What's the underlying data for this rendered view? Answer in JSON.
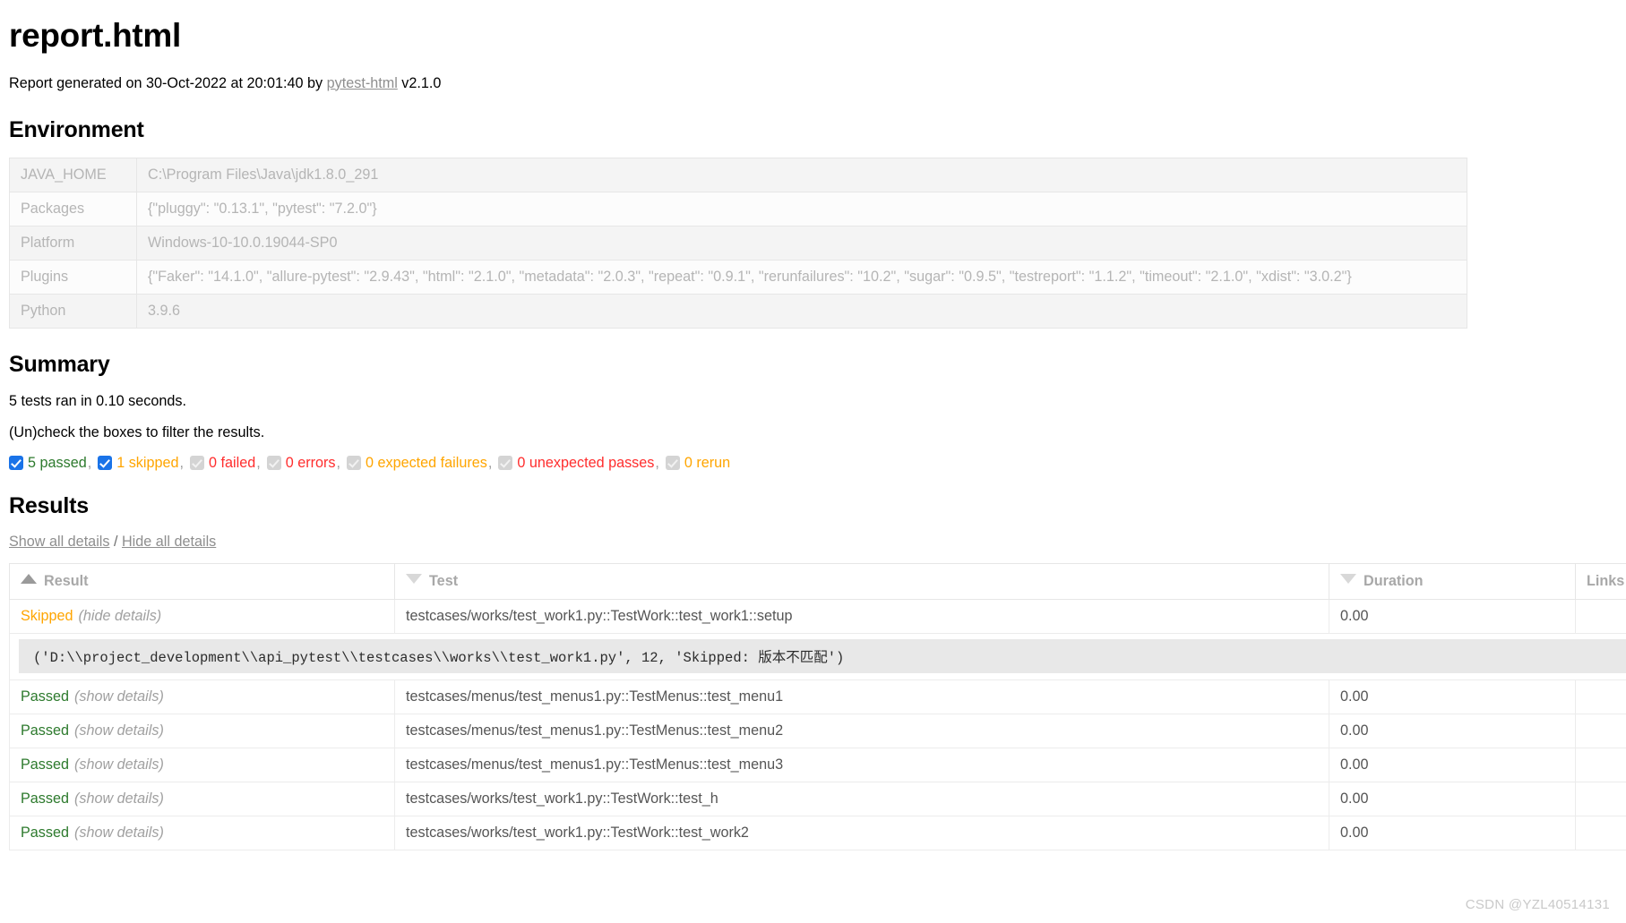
{
  "report": {
    "title": "report.html",
    "generated_prefix": "Report generated on",
    "date": "30-Oct-2022",
    "at_word": "at",
    "time": "20:01:40",
    "by_word": "by",
    "tool_link": "pytest-html",
    "tool_version": "v2.1.0"
  },
  "environment": {
    "heading": "Environment",
    "rows": [
      {
        "key": "JAVA_HOME",
        "value": "C:\\Program Files\\Java\\jdk1.8.0_291"
      },
      {
        "key": "Packages",
        "value": "{\"pluggy\": \"0.13.1\", \"pytest\": \"7.2.0\"}"
      },
      {
        "key": "Platform",
        "value": "Windows-10-10.0.19044-SP0"
      },
      {
        "key": "Plugins",
        "value": "{\"Faker\": \"14.1.0\", \"allure-pytest\": \"2.9.43\", \"html\": \"2.1.0\", \"metadata\": \"2.0.3\", \"repeat\": \"0.9.1\", \"rerunfailures\": \"10.2\", \"sugar\": \"0.9.5\", \"testreport\": \"1.1.2\", \"timeout\": \"2.1.0\", \"xdist\": \"3.0.2\"}"
      },
      {
        "key": "Python",
        "value": "3.9.6"
      }
    ]
  },
  "summary": {
    "heading": "Summary",
    "run_line": "5 tests ran in 0.10 seconds.",
    "filter_hint": "(Un)check the boxes to filter the results.",
    "filters": [
      {
        "label": "5 passed",
        "checked": true,
        "color_class": "c-passed",
        "trailing": ","
      },
      {
        "label": "1 skipped",
        "checked": true,
        "color_class": "c-skipped",
        "trailing": ","
      },
      {
        "label": "0 failed",
        "checked": false,
        "color_class": "c-failed",
        "trailing": ","
      },
      {
        "label": "0 errors",
        "checked": false,
        "color_class": "c-error",
        "trailing": ","
      },
      {
        "label": "0 expected failures",
        "checked": false,
        "color_class": "c-xfail",
        "trailing": ","
      },
      {
        "label": "0 unexpected passes",
        "checked": false,
        "color_class": "c-xpass",
        "trailing": ","
      },
      {
        "label": "0 rerun",
        "checked": false,
        "color_class": "c-rerun",
        "trailing": ""
      }
    ]
  },
  "results": {
    "heading": "Results",
    "show_all": "Show all details",
    "separator": "/",
    "hide_all": "Hide all details",
    "columns": {
      "result": "Result",
      "test": "Test",
      "duration": "Duration",
      "links": "Links"
    },
    "sort": {
      "result": "ascending",
      "test": "descending",
      "duration": "descending"
    },
    "rows": [
      {
        "status": "Skipped",
        "status_class": "res-skipped",
        "toggle": "(hide details)",
        "test": "testcases/works/test_work1.py::TestWork::test_work1::setup",
        "duration": "0.00",
        "links": "",
        "log": "('D:\\\\project_development\\\\api_pytest\\\\testcases\\\\works\\\\test_work1.py', 12, 'Skipped: 版本不匹配')"
      },
      {
        "status": "Passed",
        "status_class": "res-passed",
        "toggle": "(show details)",
        "test": "testcases/menus/test_menus1.py::TestMenus::test_menu1",
        "duration": "0.00",
        "links": ""
      },
      {
        "status": "Passed",
        "status_class": "res-passed",
        "toggle": "(show details)",
        "test": "testcases/menus/test_menus1.py::TestMenus::test_menu2",
        "duration": "0.00",
        "links": ""
      },
      {
        "status": "Passed",
        "status_class": "res-passed",
        "toggle": "(show details)",
        "test": "testcases/menus/test_menus1.py::TestMenus::test_menu3",
        "duration": "0.00",
        "links": ""
      },
      {
        "status": "Passed",
        "status_class": "res-passed",
        "toggle": "(show details)",
        "test": "testcases/works/test_work1.py::TestWork::test_h",
        "duration": "0.00",
        "links": ""
      },
      {
        "status": "Passed",
        "status_class": "res-passed",
        "toggle": "(show details)",
        "test": "testcases/works/test_work1.py::TestWork::test_work2",
        "duration": "0.00",
        "links": ""
      }
    ]
  },
  "watermark": "CSDN @YZL40514131"
}
